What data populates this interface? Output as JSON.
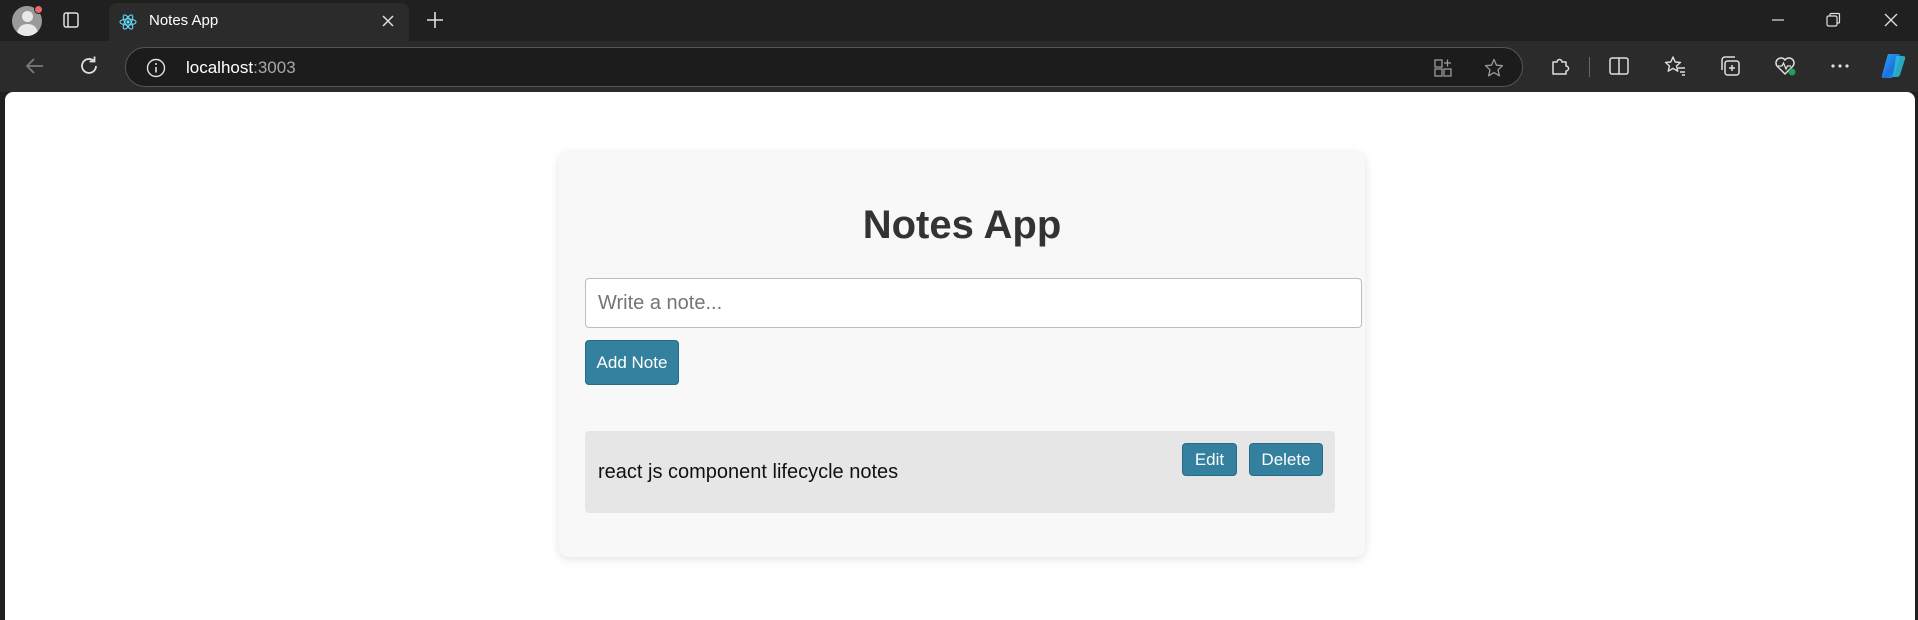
{
  "browser": {
    "tab": {
      "title": "Notes App",
      "favicon": "react-icon"
    },
    "address": {
      "host": "localhost",
      "port": ":3003"
    }
  },
  "app": {
    "title": "Notes App",
    "input": {
      "placeholder": "Write a note...",
      "value": ""
    },
    "add_button_label": "Add Note",
    "notes": [
      {
        "text": "react js component lifecycle notes",
        "edit_label": "Edit",
        "delete_label": "Delete"
      }
    ]
  },
  "colors": {
    "accent": "#33809f",
    "card_bg": "#f8f8f8",
    "note_bg": "#e6e6e6",
    "title": "#333333"
  }
}
